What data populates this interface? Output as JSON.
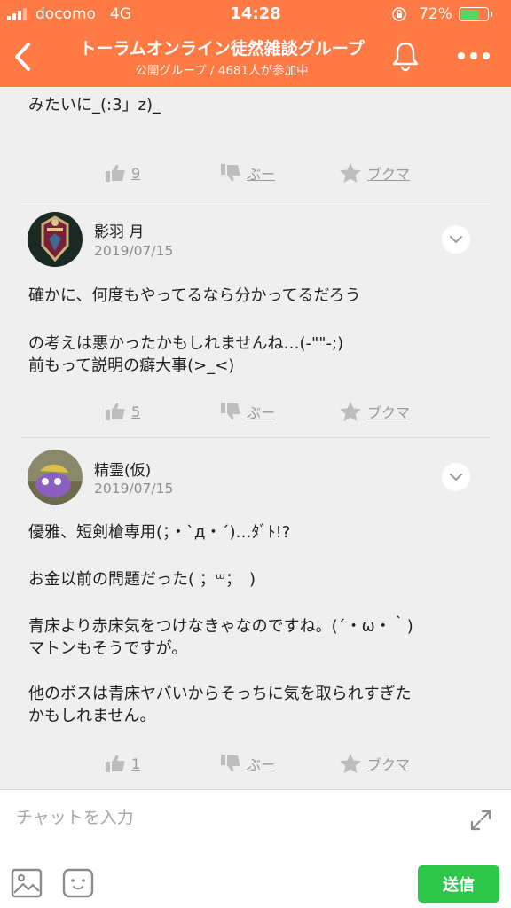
{
  "status": {
    "carrier": "docomo",
    "network": "4G",
    "time": "14:28",
    "battery": "72%"
  },
  "header": {
    "title": "トーラムオンライン徒然雑談グループ",
    "subtitle": "公開グループ / 4681人が参加中",
    "back_icon": "chevron-left-icon",
    "bell_icon": "bell-icon",
    "more_icon": "more-dots-icon"
  },
  "posts": [
    {
      "lines": [
        "みたいに_(:3」z)_"
      ],
      "likes": "9",
      "dislike_label": "ぶー",
      "bookmark_label": "ブクマ"
    },
    {
      "author": "影羽 月",
      "date": "2019/07/15",
      "lines": [
        "確かに、何度もやってるなら分かってるだろう",
        "",
        "の考えは悪かったかもしれませんね…(-\"\"-;)",
        "前もって説明の癖大事(>_<)"
      ],
      "likes": "5",
      "dislike_label": "ぶー",
      "bookmark_label": "ブクマ"
    },
    {
      "author": "精霊(仮)",
      "date": "2019/07/15",
      "lines": [
        "優雅、短剣槍専用(；・`д・´)…ﾀﾞﾄ!?",
        "",
        "お金以前の問題だった( ；ᵚ；　)",
        "",
        "青床より赤床気をつけなきゃなのですね。(´・ω・｀)",
        "マトンもそうですが。",
        "",
        "他のボスは青床ヤバいからそっちに気を取られすぎた",
        "かもしれません。"
      ],
      "likes": "1",
      "dislike_label": "ぶー",
      "bookmark_label": "ブクマ"
    }
  ],
  "composer": {
    "placeholder": "チャットを入力",
    "send_label": "送信",
    "expand_icon": "expand-icon",
    "image_icon": "image-icon",
    "stamp_icon": "stamp-icon"
  },
  "colors": {
    "header": "#ff7a45",
    "send": "#2cc64a",
    "action": "#9a9a9a"
  }
}
